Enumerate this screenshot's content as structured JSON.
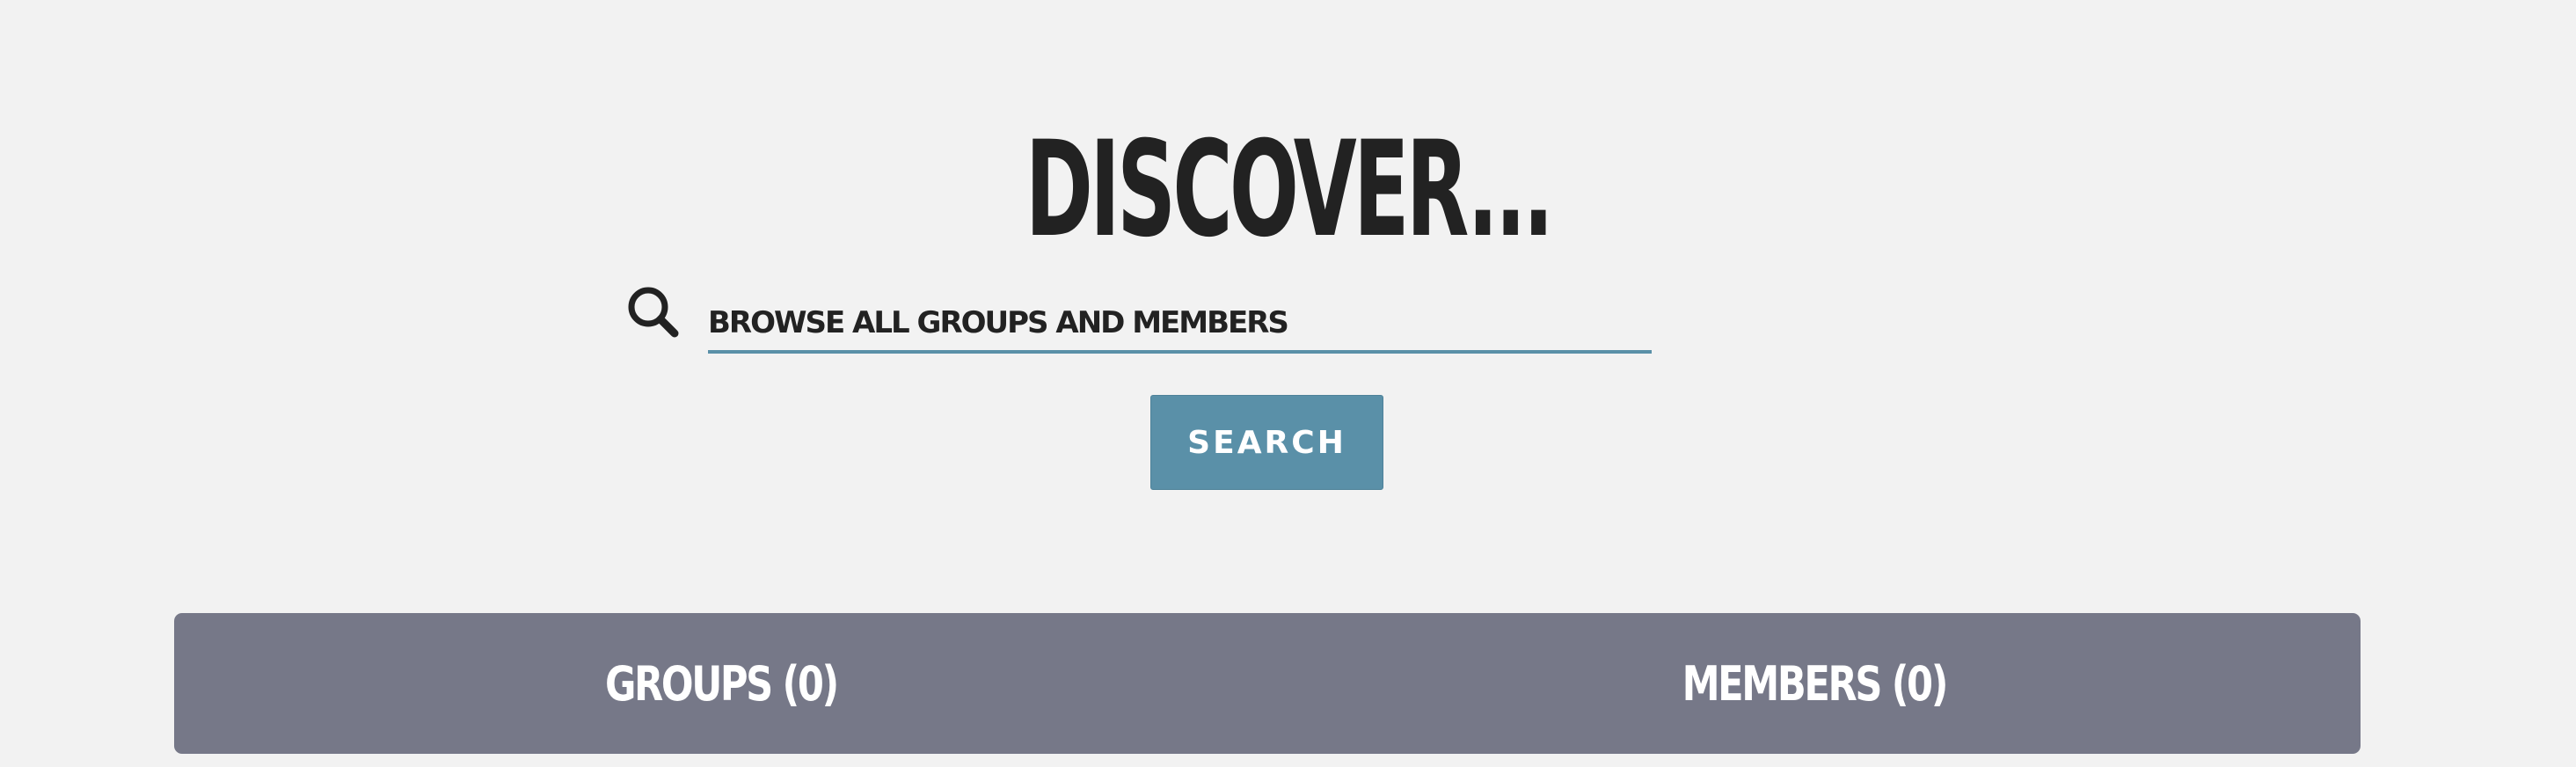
{
  "header": {
    "title": "DISCOVER..."
  },
  "search": {
    "placeholder": "BROWSE ALL GROUPS AND MEMBERS",
    "value": "",
    "icon": "search-icon",
    "button_label": "SEARCH"
  },
  "tabs": [
    {
      "label": "GROUPS (0)"
    },
    {
      "label": "MEMBERS (0)"
    }
  ],
  "colors": {
    "background": "#f2f2f2",
    "text": "#222222",
    "accent": "#5a90a8",
    "tab_bar": "#767888"
  }
}
